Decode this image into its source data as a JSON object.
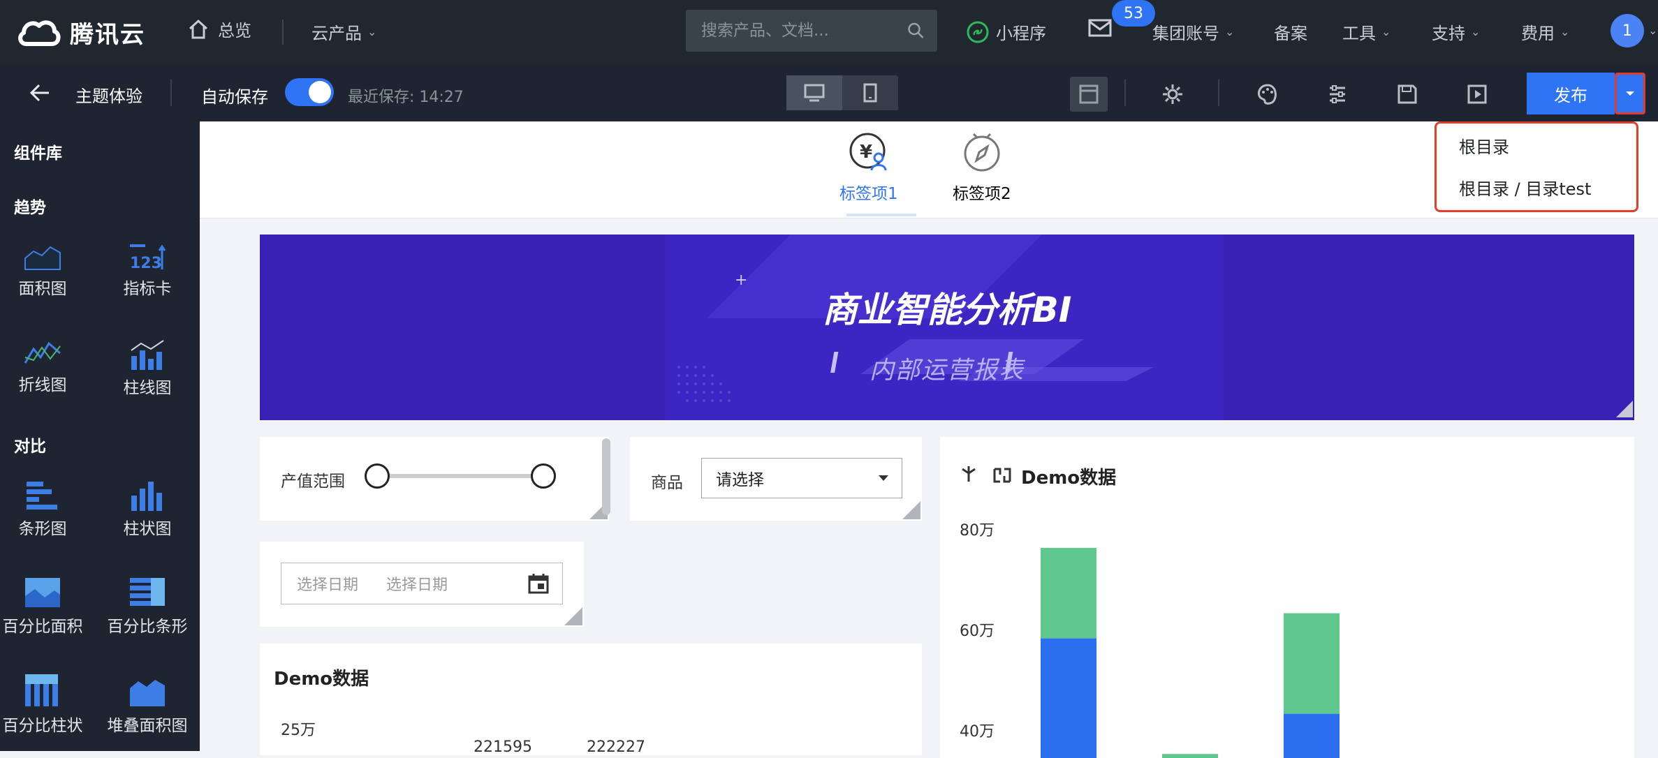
{
  "brand": {
    "name": "腾讯云"
  },
  "topnav": {
    "overview": "总览",
    "products": "云产品",
    "search_placeholder": "搜索产品、文档...",
    "miniapp": "小程序",
    "mail_badge": "53",
    "items": [
      "集团账号",
      "备案",
      "工具",
      "支持",
      "费用"
    ],
    "avatar": "1"
  },
  "toolbar": {
    "title": "主题体验",
    "autosave_label": "自动保存",
    "autosave_on": true,
    "last_save": "最近保存: 14:27",
    "publish": "发布"
  },
  "publish_menu": [
    "根目录",
    "根目录 / 目录test"
  ],
  "sidebar": {
    "title": "组件库",
    "sections": [
      {
        "name": "趋势",
        "items": [
          "面积图",
          "指标卡",
          "折线图",
          "柱线图"
        ]
      },
      {
        "name": "对比",
        "items": [
          "条形图",
          "柱状图",
          "百分比面积",
          "百分比条形",
          "百分比柱状",
          "堆叠面积图"
        ]
      }
    ]
  },
  "tabs": [
    {
      "label": "标签项1",
      "active": true
    },
    {
      "label": "标签项2",
      "active": false
    }
  ],
  "banner": {
    "title": "商业智能分析BI",
    "subtitle": "内部运营报表"
  },
  "filters": {
    "range_label": "产值范围",
    "product_label": "商品",
    "product_value": "请选择",
    "date_start_placeholder": "选择日期",
    "date_end_placeholder": "选择日期"
  },
  "chart_data": [
    {
      "type": "bar",
      "title": "Demo数据",
      "y_ticks": [
        "25万"
      ],
      "data_labels": [
        "221595",
        "222227"
      ]
    },
    {
      "type": "bar",
      "title": "Demo数据",
      "stacked": true,
      "y_ticks": [
        "80万",
        "60万",
        "40万"
      ],
      "colors": {
        "series_a": "#2b6ff0",
        "series_b": "#5fc88f"
      },
      "series": [
        {
          "values": [
            570000,
            0,
            420000
          ]
        },
        {
          "values": [
            180000,
            340000,
            200000
          ]
        }
      ],
      "ylim": [
        270000,
        800000
      ]
    }
  ]
}
